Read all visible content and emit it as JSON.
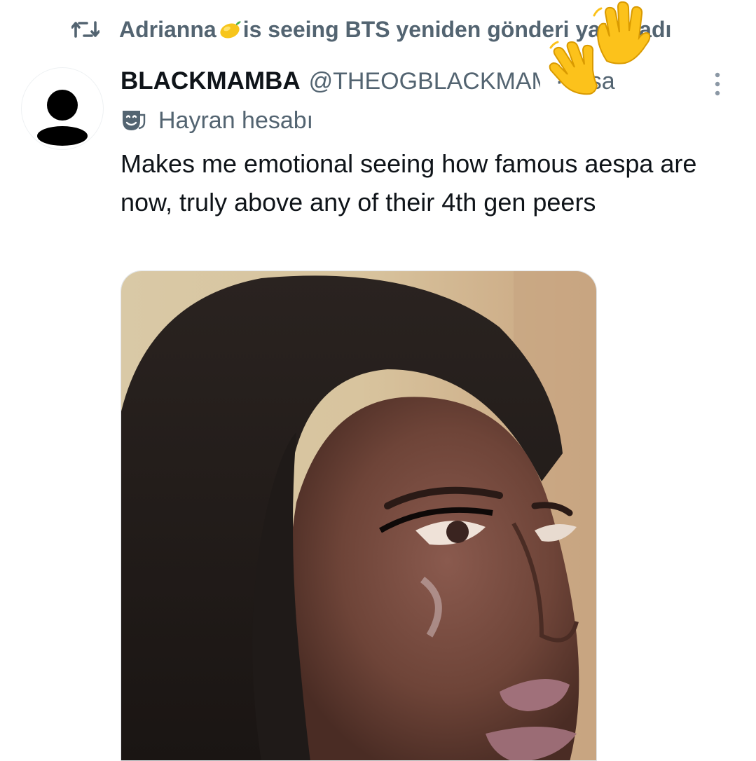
{
  "retweet": {
    "name": "Adrianna",
    "text": "is seeing BTS yeniden gönderi yayınladı",
    "icon": "retweet-icon",
    "emoji": "lemon-emoji"
  },
  "tweet": {
    "display_name": "BLACKMAMBA",
    "handle": "@THEOGBLACKMAMBA",
    "time": "· 4 sa",
    "label": "Hayran hesabı",
    "label_icon": "theater-mask-icon",
    "text": "Makes me emotional seeing how famous aespa are now, truly above any of their 4th gen peers",
    "more_icon": "more-vertical-icon"
  },
  "overlay": {
    "emoji": "waving-hand-emoji"
  },
  "colors": {
    "text_primary": "#0f1419",
    "text_secondary": "#536471",
    "background": "#ffffff"
  }
}
